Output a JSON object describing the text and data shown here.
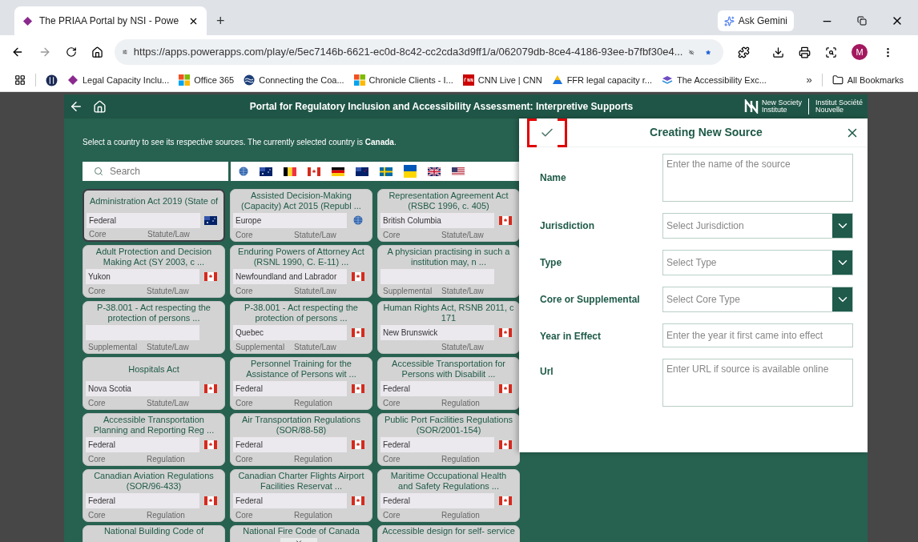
{
  "browser": {
    "tab_title": "The PRIAA Portal by NSI - Powe",
    "new_tab": "+",
    "gemini": "Ask Gemini",
    "url": "https://apps.powerapps.com/play/e/5ec7146b-6621-ec0d-8c42-cc2cda3d9ff1/a/062079db-8ce4-4186-93ee-b7fbf30e4...",
    "profile": "M",
    "bookmarks": [
      {
        "label": "Legal Capacity Inclu...",
        "kind": "diamond"
      },
      {
        "label": "Office 365",
        "kind": "squares"
      },
      {
        "label": "Connecting the Coa...",
        "kind": "wave"
      },
      {
        "label": "Chronicle Clients - I...",
        "kind": "squares"
      },
      {
        "label": "CNN Live | CNN",
        "kind": "cnn"
      },
      {
        "label": "FFR legal capacity r...",
        "kind": "drive"
      },
      {
        "label": "The Accessibility Exc...",
        "kind": "stack"
      }
    ],
    "more": "»",
    "all_bookmarks": "All Bookmarks"
  },
  "app": {
    "title": "Portal for Regulatory Inclusion and Accessibility Assessment: Interpretive Supports",
    "logo_en": [
      "New Society",
      "Institute"
    ],
    "logo_fr": [
      "Institut Société",
      "Nouvelle"
    ],
    "intro": "Select a country to see its respective sources. The currently selected country is **Canada**.",
    "search": {
      "placeholder": "Search"
    },
    "countries": [
      {
        "kind": "globe"
      },
      {
        "kind": "au"
      },
      {
        "kind": "be"
      },
      {
        "kind": "ca"
      },
      {
        "kind": "de"
      },
      {
        "kind": "nz"
      },
      {
        "kind": "se"
      },
      {
        "kind": "ua"
      },
      {
        "kind": "gb"
      },
      {
        "kind": "us"
      }
    ],
    "cards": [
      {
        "lines": [
          "Administration Act 2019 (State of"
        ],
        "jurisdiction": "Federal",
        "kind": "au",
        "core": "Core",
        "type": "Statute/Law",
        "selected": true
      },
      {
        "lines": [
          "Assisted Decision-Making",
          "(Capacity) Act 2015 (Republ ..."
        ],
        "jurisdiction": "Europe",
        "kind": "globe",
        "core": "Core",
        "type": "Statute/Law",
        "selected": false
      },
      {
        "lines": [
          "Representation Agreement Act",
          "(RSBC 1996, c. 405)"
        ],
        "jurisdiction": "British Columbia",
        "kind": "ca",
        "core": "Core",
        "type": "Statute/Law",
        "selected": false
      },
      {
        "lines": [
          "Adult Protection and Decision",
          "Making Act (SY 2003, c ..."
        ],
        "jurisdiction": "Yukon",
        "kind": "ca",
        "core": "Core",
        "type": "Statute/Law",
        "selected": false
      },
      {
        "lines": [
          "Enduring Powers of Attorney Act",
          "(RSNL 1990, C. E-11) ..."
        ],
        "jurisdiction": "Newfoundland and Labrador",
        "kind": "ca",
        "core": "Core",
        "type": "Statute/Law",
        "selected": false
      },
      {
        "lines": [
          "A physician practising in such a",
          "institution may, n ..."
        ],
        "core": "Supplemental",
        "type": "Statute/Law",
        "selected": false
      },
      {
        "lines": [
          "P-38.001 - Act respecting the",
          "protection of persons  ..."
        ],
        "core": "Supplemental",
        "type": "Statute/Law",
        "selected": false
      },
      {
        "lines": [
          "P-38.001 - Act respecting the",
          "protection of persons  ..."
        ],
        "jurisdiction": "Quebec",
        "kind": "ca",
        "core": "Supplemental",
        "type": "Statute/Law",
        "selected": false
      },
      {
        "lines": [
          "Human Rights Act, RSNB 2011, c",
          "171"
        ],
        "jurisdiction": "New Brunswick",
        "kind": "ca",
        "type": "Statute/Law",
        "selected": false
      },
      {
        "lines": [
          "Hospitals Act"
        ],
        "jurisdiction": "Nova Scotia",
        "kind": "ca",
        "core": "Core",
        "type": "Statute/Law",
        "selected": false
      },
      {
        "lines": [
          "Personnel Training for the",
          "Assistance of Persons wit ..."
        ],
        "jurisdiction": "Federal",
        "kind": "ca",
        "core": "Core",
        "type": "Regulation",
        "selected": false
      },
      {
        "lines": [
          "Accessible Transportation for",
          "Persons with Disabilit ..."
        ],
        "jurisdiction": "Federal",
        "kind": "ca",
        "core": "Core",
        "type": "Regulation",
        "selected": false
      },
      {
        "lines": [
          "Accessible Transportation",
          "Planning and Reporting Reg ..."
        ],
        "jurisdiction": "Federal",
        "kind": "ca",
        "core": "Core",
        "type": "Regulation",
        "selected": false
      },
      {
        "lines": [
          "Air Transportation Regulations",
          "(SOR/88-58)"
        ],
        "jurisdiction": "Federal",
        "kind": "ca",
        "core": "Core",
        "type": "Regulation",
        "selected": false
      },
      {
        "lines": [
          "Public Port Facilities Regulations",
          "(SOR/2001-154)"
        ],
        "jurisdiction": "Federal",
        "kind": "ca",
        "core": "Core",
        "type": "Regulation",
        "selected": false
      },
      {
        "lines": [
          "Canadian Aviation Regulations",
          "(SOR/96-433)"
        ],
        "jurisdiction": "Federal",
        "kind": "ca",
        "core": "Core",
        "type": "Regulation",
        "selected": false
      },
      {
        "lines": [
          "Canadian Charter Flights Airport",
          "Facilities Reservat ..."
        ],
        "jurisdiction": "Federal",
        "kind": "ca",
        "core": "Core",
        "type": "Regulation",
        "selected": false
      },
      {
        "lines": [
          "Maritime Occupational Health",
          "and Safety Regulations  ..."
        ],
        "jurisdiction": "Federal",
        "kind": "ca",
        "core": "Core",
        "type": "Regulation",
        "selected": false
      },
      {
        "lines": [
          "National Building Code of"
        ],
        "selected": false
      },
      {
        "lines": [
          "National Fire Code of Canada"
        ],
        "selected": false
      },
      {
        "lines": [
          "Accessible design for self- service"
        ],
        "selected": false
      }
    ]
  },
  "dialog": {
    "title": "Creating New Source",
    "save_highlighted": true,
    "fields": [
      {
        "kind": "textarea",
        "label": "Name",
        "placeholder": "Enter the name of the source"
      },
      {
        "kind": "select",
        "label": "Jurisdiction",
        "placeholder": "Select Jurisdiction"
      },
      {
        "kind": "select",
        "label": "Type",
        "placeholder": "Select Type"
      },
      {
        "kind": "select",
        "label": "Core or Supplemental",
        "placeholder": "Select Core Type"
      },
      {
        "kind": "input",
        "label": "Year in Effect",
        "placeholder": "Enter the year it first came into effect"
      },
      {
        "kind": "textarea",
        "label": "Url",
        "placeholder": "Enter URL if source is available online"
      }
    ]
  }
}
